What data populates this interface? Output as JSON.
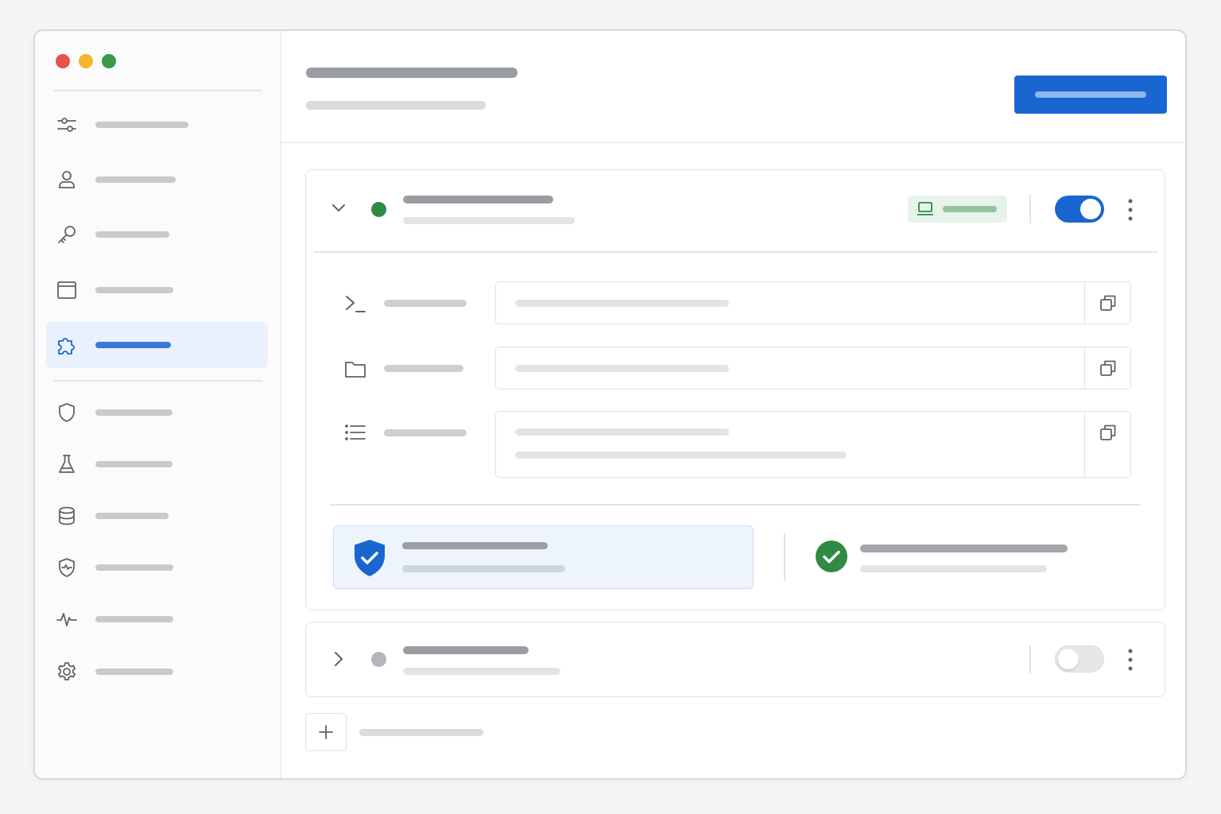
{
  "window": {
    "controls": [
      "close",
      "minimize",
      "maximize"
    ],
    "colors": {
      "close": "#e5534b",
      "minimize": "#f3b62d",
      "maximize": "#3a9a47"
    }
  },
  "sidebar": {
    "items": [
      {
        "icon": "sliders-icon",
        "active": false
      },
      {
        "icon": "user-icon",
        "active": false
      },
      {
        "icon": "key-icon",
        "active": false
      },
      {
        "icon": "window-icon",
        "active": false
      },
      {
        "icon": "puzzle-icon",
        "active": true
      },
      {
        "icon": "shield-icon",
        "active": false
      },
      {
        "icon": "flask-icon",
        "active": false
      },
      {
        "icon": "database-icon",
        "active": false
      },
      {
        "icon": "shield-pulse-icon",
        "active": false
      },
      {
        "icon": "activity-icon",
        "active": false
      },
      {
        "icon": "gear-icon",
        "active": false
      }
    ]
  },
  "colors": {
    "accent": "#1a66d0",
    "active_bg": "#e9f1fe",
    "success": "#2f8a43",
    "inactive": "#b3b6ba"
  },
  "servers": [
    {
      "expanded": true,
      "status": "connected",
      "enabled": true,
      "env_icon": "laptop-icon",
      "fields": [
        {
          "icon": "terminal-icon",
          "multiline": false
        },
        {
          "icon": "folder-icon",
          "multiline": false
        },
        {
          "icon": "list-icon",
          "multiline": true
        }
      ],
      "verification": {
        "icon": "shield-check-icon",
        "status_icon": "check-circle-icon"
      }
    },
    {
      "expanded": false,
      "status": "disconnected",
      "enabled": false
    }
  ],
  "footer": {
    "add_icon": "plus-icon"
  }
}
